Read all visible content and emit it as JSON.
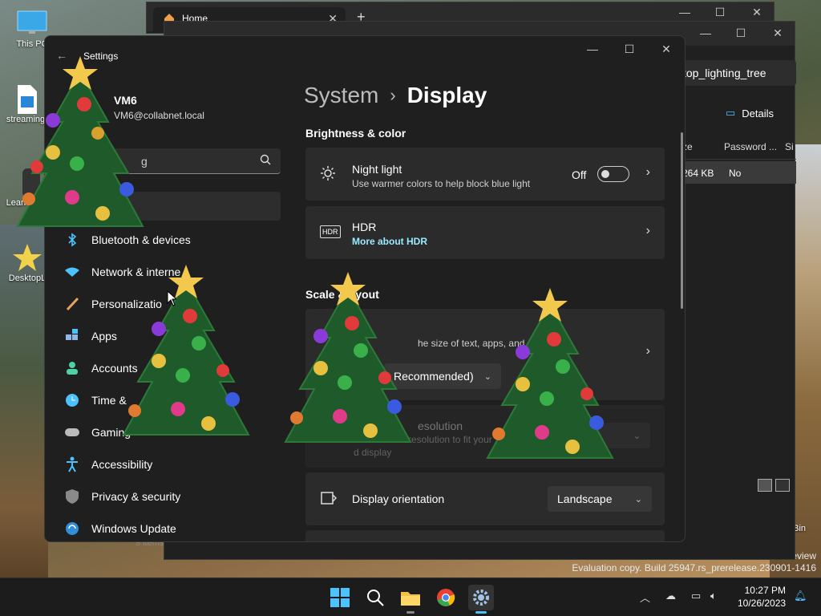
{
  "desktop": {
    "icons": [
      {
        "label": "This PC",
        "name": "this-pc"
      },
      {
        "label": "streaming",
        "name": "streaming"
      },
      {
        "label": "Lean this",
        "name": "learn-this"
      },
      {
        "label": "DesktopL",
        "name": "desktop-lighting"
      },
      {
        "label": "Recycle Bin",
        "name": "recycle-bin"
      }
    ],
    "watermark": {
      "line1": "Windows 11 Pro Insider Preview",
      "line2": "Evaluation copy. Build 25947.rs_prerelease.230901-1416"
    }
  },
  "explorer": {
    "tab_label": "Home",
    "new_tab": "+",
    "address": "ktop_lighting_tree",
    "details_label": "Details",
    "columns": [
      "ze",
      "Password ...",
      "Si"
    ],
    "row": {
      "size": "264 KB",
      "password": "No"
    },
    "status": "9 items"
  },
  "settings": {
    "title": "Settings",
    "user": {
      "name": "VM6",
      "email": "VM6@collabnet.local"
    },
    "search_placeholder": "g",
    "breadcrumb": {
      "parent": "System",
      "separator": "›",
      "current": "Display"
    },
    "nav": [
      {
        "label": "Bluetooth & devices",
        "name": "bluetooth"
      },
      {
        "label": "Network & interne",
        "name": "network"
      },
      {
        "label": "Personalizatio",
        "name": "personalization"
      },
      {
        "label": "Apps",
        "name": "apps"
      },
      {
        "label": "Accounts",
        "name": "accounts"
      },
      {
        "label": "Time &",
        "name": "time"
      },
      {
        "label": "Gaming",
        "name": "gaming"
      },
      {
        "label": "Accessibility",
        "name": "accessibility"
      },
      {
        "label": "Privacy & security",
        "name": "privacy"
      },
      {
        "label": "Windows Update",
        "name": "windows-update"
      }
    ],
    "sections": {
      "brightness": "Brightness & color",
      "scale": "Scale & ayout"
    },
    "night_light": {
      "title": "Night light",
      "sub": "Use warmer colors to help block blue light",
      "state": "Off"
    },
    "hdr": {
      "title": "HDR",
      "link": "More about HDR"
    },
    "scale_card": {
      "sub": "he size of text, apps, and oth",
      "value": "Recommended)"
    },
    "resolution": {
      "title": "esolution",
      "sub1": "the resolution to fit your",
      "sub2": "d display"
    },
    "orientation": {
      "title": "Display orientation",
      "value": "Landscape"
    }
  },
  "taskbar": {
    "time": "10:27 PM",
    "date": "10/26/2023"
  },
  "colors": {
    "accent": "#4cc2ff",
    "link": "#99ebff"
  }
}
